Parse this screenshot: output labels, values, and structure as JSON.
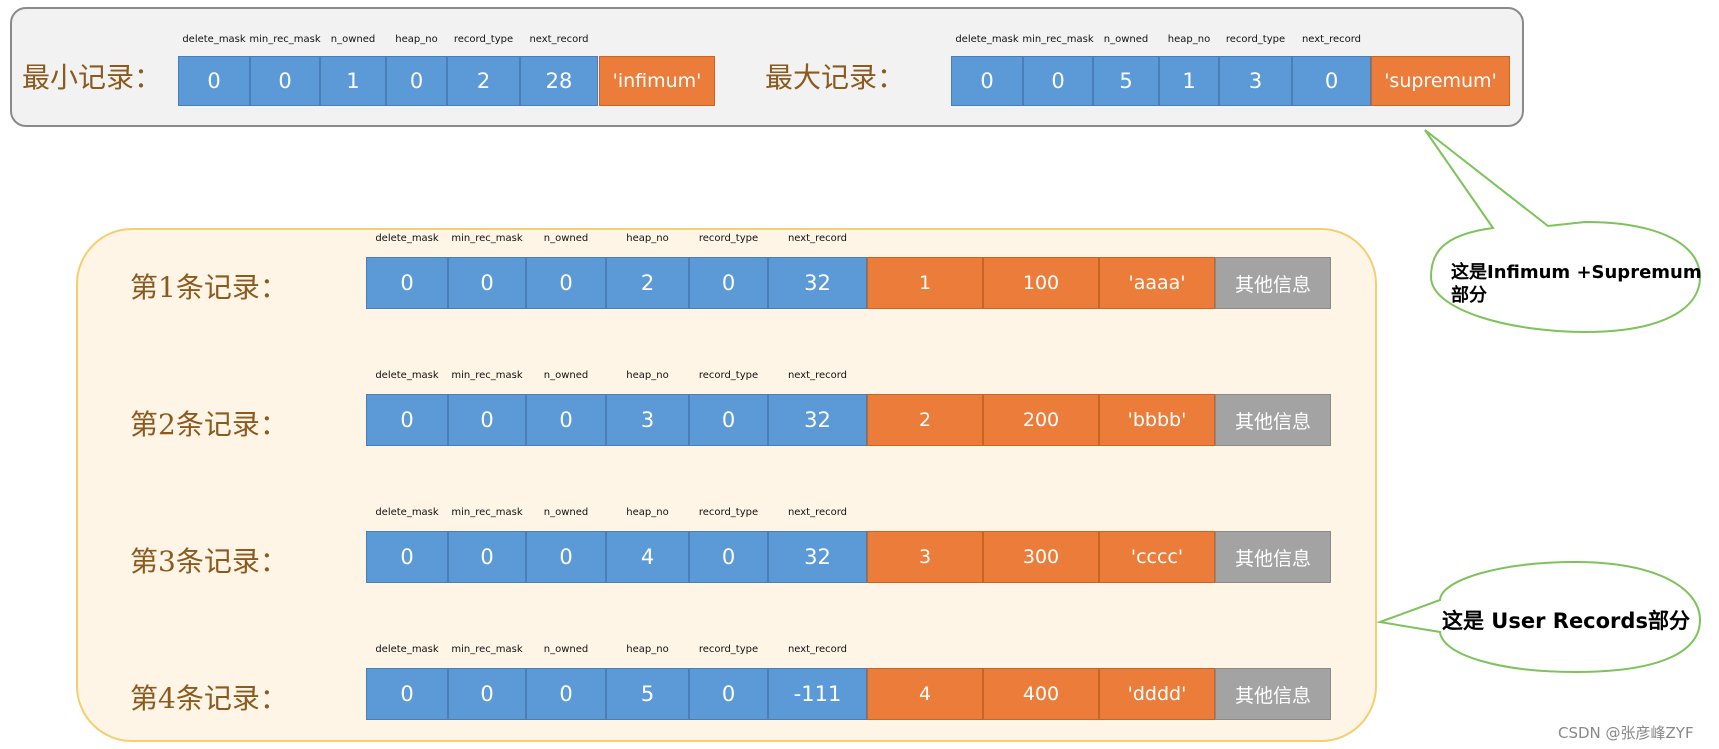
{
  "header_fields": [
    "delete_mask",
    "min_rec_mask",
    "n_owned",
    "heap_no",
    "record_type",
    "next_record"
  ],
  "infimum": {
    "label": "最小记录：",
    "header_values": [
      "0",
      "0",
      "1",
      "0",
      "2",
      "28"
    ],
    "body": "'infimum'"
  },
  "supremum": {
    "label": "最大记录：",
    "header_values": [
      "0",
      "0",
      "5",
      "1",
      "3",
      "0"
    ],
    "body": "'supremum'"
  },
  "records": [
    {
      "label": "第1条记录：",
      "header_values": [
        "0",
        "0",
        "0",
        "2",
        "0",
        "32"
      ],
      "columns": [
        "1",
        "100",
        "'aaaa'"
      ],
      "other": "其他信息"
    },
    {
      "label": "第2条记录：",
      "header_values": [
        "0",
        "0",
        "0",
        "3",
        "0",
        "32"
      ],
      "columns": [
        "2",
        "200",
        "'bbbb'"
      ],
      "other": "其他信息"
    },
    {
      "label": "第3条记录：",
      "header_values": [
        "0",
        "0",
        "0",
        "4",
        "0",
        "32"
      ],
      "columns": [
        "3",
        "300",
        "'cccc'"
      ],
      "other": "其他信息"
    },
    {
      "label": "第4条记录：",
      "header_values": [
        "0",
        "0",
        "0",
        "5",
        "0",
        "-111"
      ],
      "columns": [
        "4",
        "400",
        "'dddd'"
      ],
      "other": "其他信息"
    }
  ],
  "callouts": {
    "infimum_supremum": {
      "line1": "这是Infimum +Supremum",
      "line2": "部分"
    },
    "user_records": "这是 User Records部分"
  },
  "watermark": "CSDN @张彦峰ZYF",
  "colors": {
    "header_cell": "#5b9ad6",
    "column_cell": "#ec7c3a",
    "other_cell": "#a3a3a3",
    "callout_border": "#7dc35a"
  }
}
